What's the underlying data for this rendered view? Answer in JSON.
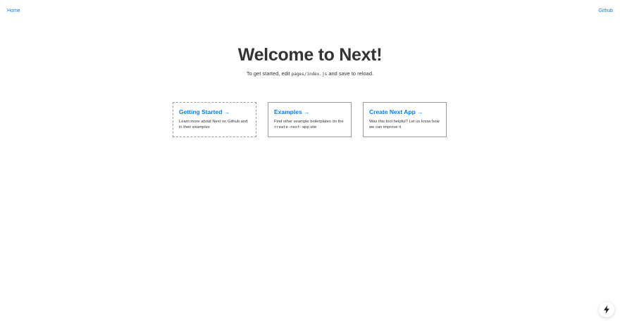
{
  "nav": {
    "home_label": "Home",
    "github_label": "Github"
  },
  "hero": {
    "title": "Welcome to Next!",
    "desc_before": "To get started, edit ",
    "desc_code": "pages/index.js",
    "desc_after": " and save to reload."
  },
  "cards": [
    {
      "title": "Getting Started →",
      "desc": "Learn more about Next on Github and in their examples"
    },
    {
      "title": "Examples →",
      "desc_before": "Find other example boilerplates on the ",
      "desc_code": "create-next-app",
      "desc_after": " site"
    },
    {
      "title": "Create Next App →",
      "desc": "Was this tool helpful? Let us know how we can improve it"
    }
  ],
  "dev_indicator": {
    "icon": "lightning-bolt-icon"
  },
  "colors": {
    "link": "#067df7",
    "text": "#333333",
    "border": "#9b9b9b"
  }
}
